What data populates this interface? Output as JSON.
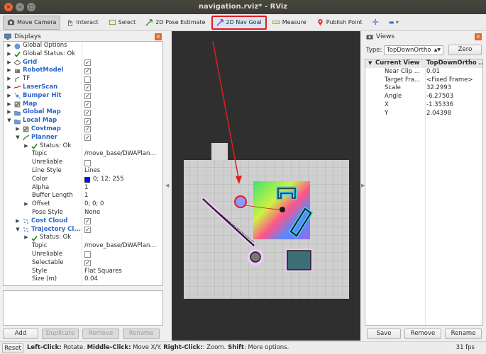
{
  "window": {
    "title": "navigation.rviz* - RViz",
    "close": "×",
    "minimize": "–",
    "maximize": "□"
  },
  "toolbar": {
    "move_camera": "Move Camera",
    "interact": "Interact",
    "select": "Select",
    "pose_estimate": "2D Pose Estimate",
    "nav_goal": "2D Nav Goal",
    "measure": "Measure",
    "publish_point": "Publish Point",
    "plus": "✛",
    "minus": "▬ ▾"
  },
  "displays": {
    "header": "Displays",
    "close": "×",
    "rows": [
      {
        "label": "Global Options",
        "indent": 0,
        "exp": "▶",
        "icon": "globe",
        "style": "",
        "value": "",
        "check": null
      },
      {
        "label": "Global Status: Ok",
        "indent": 0,
        "exp": "▶",
        "icon": "tick",
        "style": "",
        "value": "",
        "check": null
      },
      {
        "label": "Grid",
        "indent": 0,
        "exp": "▶",
        "icon": "grid",
        "style": "blue",
        "value": "",
        "check": true
      },
      {
        "label": "RobotModel",
        "indent": 0,
        "exp": "▶",
        "icon": "robot",
        "style": "blue",
        "value": "",
        "check": true
      },
      {
        "label": "TF",
        "indent": 0,
        "exp": "▶",
        "icon": "tf",
        "style": "",
        "value": "",
        "check": false
      },
      {
        "label": "LaserScan",
        "indent": 0,
        "exp": "▶",
        "icon": "laser",
        "style": "blue",
        "value": "",
        "check": true
      },
      {
        "label": "Bumper Hit",
        "indent": 0,
        "exp": "▶",
        "icon": "bumper",
        "style": "blue",
        "value": "",
        "check": true
      },
      {
        "label": "Map",
        "indent": 0,
        "exp": "▶",
        "icon": "map",
        "style": "blue",
        "value": "",
        "check": true
      },
      {
        "label": "Global Map",
        "indent": 0,
        "exp": "▶",
        "icon": "folder",
        "style": "blue",
        "value": "",
        "check": true
      },
      {
        "label": "Local Map",
        "indent": 0,
        "exp": "▼",
        "icon": "folder",
        "style": "blue",
        "value": "",
        "check": true
      },
      {
        "label": "Costmap",
        "indent": 1,
        "exp": "▶",
        "icon": "map",
        "style": "blue",
        "value": "",
        "check": true
      },
      {
        "label": "Planner",
        "indent": 1,
        "exp": "▼",
        "icon": "path",
        "style": "blue",
        "value": "",
        "check": true
      },
      {
        "label": "Status: Ok",
        "indent": 2,
        "exp": "▶",
        "icon": "tick",
        "style": "",
        "value": "",
        "check": null
      },
      {
        "label": "Topic",
        "indent": 2,
        "exp": "",
        "icon": "",
        "style": "",
        "value": "/move_base/DWAPlan...",
        "check": null
      },
      {
        "label": "Unreliable",
        "indent": 2,
        "exp": "",
        "icon": "",
        "style": "",
        "value": "",
        "check": false
      },
      {
        "label": "Line Style",
        "indent": 2,
        "exp": "",
        "icon": "",
        "style": "",
        "value": "Lines",
        "check": null
      },
      {
        "label": "Color",
        "indent": 2,
        "exp": "",
        "icon": "",
        "style": "",
        "value": "0; 12; 255",
        "check": null,
        "swatch": "#000cff"
      },
      {
        "label": "Alpha",
        "indent": 2,
        "exp": "",
        "icon": "",
        "style": "",
        "value": "1",
        "check": null
      },
      {
        "label": "Buffer Length",
        "indent": 2,
        "exp": "",
        "icon": "",
        "style": "",
        "value": "1",
        "check": null
      },
      {
        "label": "Offset",
        "indent": 2,
        "exp": "▶",
        "icon": "",
        "style": "",
        "value": "0; 0; 0",
        "check": null
      },
      {
        "label": "Pose Style",
        "indent": 2,
        "exp": "",
        "icon": "",
        "style": "",
        "value": "None",
        "check": null
      },
      {
        "label": "Cost Cloud",
        "indent": 1,
        "exp": "▶",
        "icon": "cloud",
        "style": "blue",
        "value": "",
        "check": true
      },
      {
        "label": "Trajectory Cl...",
        "indent": 1,
        "exp": "▼",
        "icon": "cloud",
        "style": "blue",
        "value": "",
        "check": true
      },
      {
        "label": "Status: Ok",
        "indent": 2,
        "exp": "▶",
        "icon": "tick",
        "style": "",
        "value": "",
        "check": null
      },
      {
        "label": "Topic",
        "indent": 2,
        "exp": "",
        "icon": "",
        "style": "",
        "value": "/move_base/DWAPlan...",
        "check": null
      },
      {
        "label": "Unreliable",
        "indent": 2,
        "exp": "",
        "icon": "",
        "style": "",
        "value": "",
        "check": false
      },
      {
        "label": "Selectable",
        "indent": 2,
        "exp": "",
        "icon": "",
        "style": "",
        "value": "",
        "check": true
      },
      {
        "label": "Style",
        "indent": 2,
        "exp": "",
        "icon": "",
        "style": "",
        "value": "Flat Squares",
        "check": null
      },
      {
        "label": "Size (m)",
        "indent": 2,
        "exp": "",
        "icon": "",
        "style": "",
        "value": "0.04",
        "check": null
      }
    ],
    "buttons": {
      "add": "Add",
      "duplicate": "Duplicate",
      "remove": "Remove",
      "rename": "Rename"
    }
  },
  "views": {
    "header": "Views",
    "close": "×",
    "type_label": "Type:",
    "type_value": "TopDownOrtho",
    "zero": "Zero",
    "current_view": "Current View",
    "current_view_type": "TopDownOrtho ...",
    "props": [
      {
        "k": "Near Clip ...",
        "v": "0.01"
      },
      {
        "k": "Target Fra...",
        "v": "<Fixed Frame>"
      },
      {
        "k": "Scale",
        "v": "32.2993"
      },
      {
        "k": "Angle",
        "v": "-6.27503"
      },
      {
        "k": "X",
        "v": "-1.35336"
      },
      {
        "k": "Y",
        "v": "2.04398"
      }
    ],
    "buttons": {
      "save": "Save",
      "remove": "Remove",
      "rename": "Rename"
    }
  },
  "statusbar": {
    "reset": "Reset",
    "left_click": "Left-Click:",
    "left_action": " Rotate. ",
    "middle_click": "Middle-Click:",
    "middle_action": " Move X/Y. ",
    "right_click": "Right-Click:",
    "right_action": ": Zoom. ",
    "shift": "Shift",
    "shift_action": ": More options.",
    "fps": "31 fps"
  },
  "colors": {
    "accent": "#e01d1d",
    "link": "#2b66c8",
    "ok": "#1a8a1a"
  }
}
